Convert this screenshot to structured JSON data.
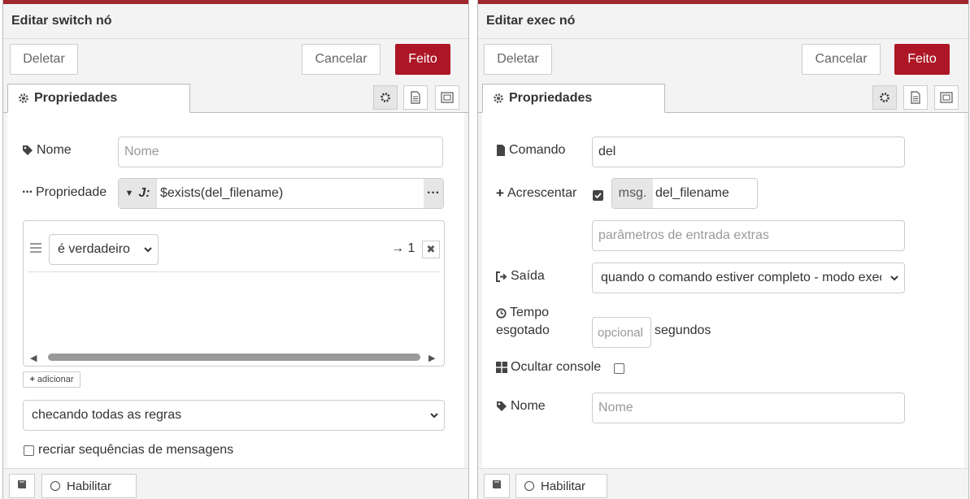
{
  "colors": {
    "accent": "#ad1625",
    "topbar": "#a0282d"
  },
  "left": {
    "title": "Editar switch nó",
    "delete": "Deletar",
    "cancel": "Cancelar",
    "done": "Feito",
    "tab": "Propriedades",
    "name_label": "Nome",
    "name_placeholder": "Nome",
    "property_label": "Propriedade",
    "property_value": "$exists(del_filename)",
    "rule_operator": "é verdadeiro",
    "rule_output": "→ 1",
    "add_button": "adicionar",
    "check_mode": "checando todas as regras",
    "recreate_label": "recriar sequências de mensagens",
    "enable": "Habilitar"
  },
  "right": {
    "title": "Editar exec nó",
    "delete": "Deletar",
    "cancel": "Cancelar",
    "done": "Feito",
    "tab": "Propriedades",
    "command_label": "Comando",
    "command_value": "del",
    "append_label": "Acrescentar",
    "append_prefix": "msg.",
    "append_value": "del_filename",
    "extra_placeholder": "parâmetros de entrada extras",
    "output_label": "Saída",
    "output_value": "quando o comando estiver completo - modo exec",
    "timeout_label_1": "Tempo",
    "timeout_label_2": "esgotado",
    "timeout_placeholder": "opcional",
    "timeout_unit": "segundos",
    "hide_console_label": "Ocultar console",
    "name_label": "Nome",
    "name_placeholder": "Nome",
    "enable": "Habilitar"
  }
}
